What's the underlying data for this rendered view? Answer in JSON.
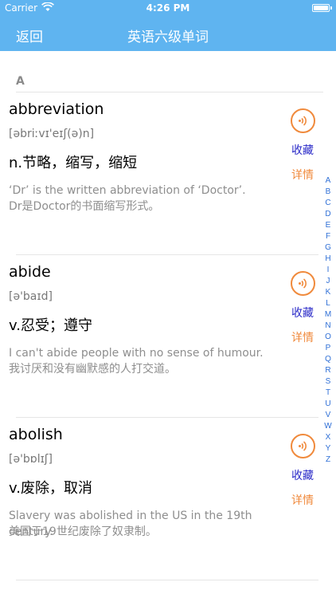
{
  "status_bar": {
    "carrier": "Carrier",
    "time": "4:26 PM"
  },
  "nav": {
    "back_label": "返回",
    "title": "英语六级单词"
  },
  "section": {
    "letter": "A"
  },
  "entries": [
    {
      "word": "abbreviation",
      "phonetic": "[əbriːvɪ'eɪʃ(ə)n]",
      "meaning": "n.节略，缩写，缩短",
      "example_en": "‘Dr’ is the written abbreviation of ‘Doctor’.",
      "example_cn": "Dr是Doctor的书面缩写形式。",
      "fav_label": "收藏",
      "detail_label": "详情"
    },
    {
      "word": "abide",
      "phonetic": "[ə'baɪd]",
      "meaning": "v.忍受；遵守",
      "example_en": "I can't abide people with no sense of humour.",
      "example_cn": "我讨厌和没有幽默感的人打交道。",
      "fav_label": "收藏",
      "detail_label": "详情"
    },
    {
      "word": "abolish",
      "phonetic": "[ə'bɒlɪʃ]",
      "meaning": "v.废除，取消",
      "example_en": "Slavery was abolished in the US in the 19th century.",
      "example_cn": "美国于19世纪废除了奴隶制。",
      "fav_label": "收藏",
      "detail_label": "详情"
    }
  ],
  "index_letters": [
    "A",
    "B",
    "C",
    "D",
    "E",
    "F",
    "G",
    "H",
    "I",
    "J",
    "K",
    "L",
    "M",
    "N",
    "O",
    "P",
    "Q",
    "R",
    "S",
    "T",
    "U",
    "V",
    "W",
    "X",
    "Y",
    "Z"
  ],
  "colors": {
    "nav_bg": "#5fb4f0",
    "accent_orange": "#f08a3c",
    "fav_blue": "#2a2ac8",
    "index_blue": "#2f6fd6"
  },
  "icons": {
    "sound": "speaker-wave-icon",
    "wifi": "wifi-icon",
    "battery": "battery-icon"
  }
}
